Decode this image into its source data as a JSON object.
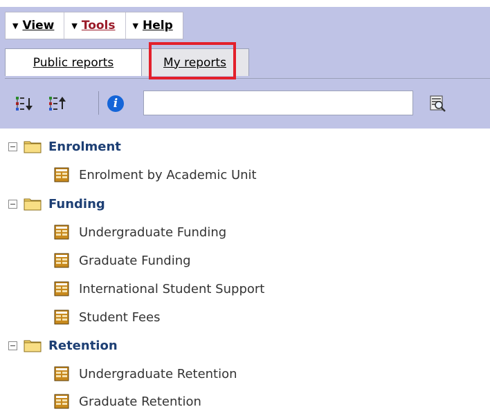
{
  "menu": [
    {
      "label": "View"
    },
    {
      "label": "Tools"
    },
    {
      "label": "Help"
    }
  ],
  "tabs": {
    "public": "Public reports",
    "my": "My reports"
  },
  "search": {
    "value": ""
  },
  "tree": [
    {
      "label": "Enrolment",
      "items": [
        "Enrolment by Academic Unit"
      ]
    },
    {
      "label": "Funding",
      "items": [
        "Undergraduate Funding",
        "Graduate Funding",
        "International Student Support",
        "Student Fees"
      ]
    },
    {
      "label": "Retention",
      "items": [
        "Undergraduate Retention",
        "Graduate Retention"
      ]
    }
  ],
  "icons": {
    "info": "i",
    "sort_down": "sort-down-icon",
    "sort_up": "sort-up-icon",
    "preview": "report-preview-icon",
    "folder": "folder-icon",
    "report": "report-icon",
    "collapse": "collapse-icon"
  },
  "colors": {
    "toolbar_bg": "#bfc3e6",
    "folder_text": "#1d3f74",
    "highlight": "#e3202b",
    "tools_text": "#9a1a28",
    "info_blue": "#1565d8"
  }
}
